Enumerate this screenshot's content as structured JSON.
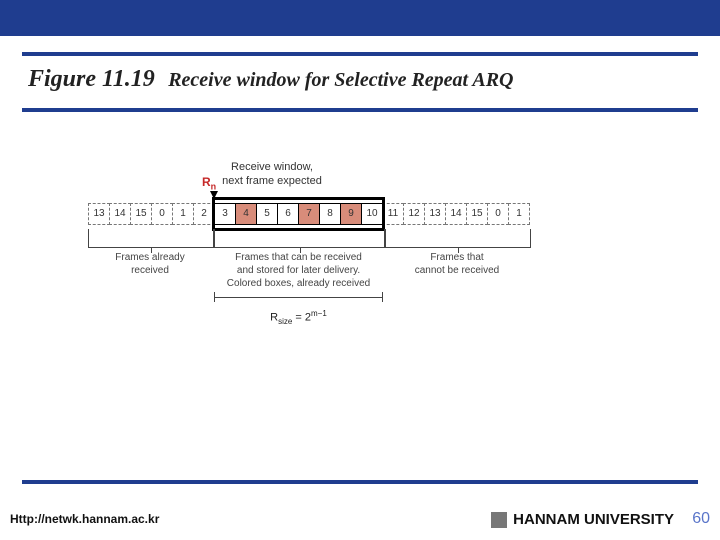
{
  "header": {
    "figure_label": "Figure 11.19",
    "figure_title": "Receive window for Selective Repeat ARQ"
  },
  "diagram": {
    "rn_symbol": "R",
    "rn_sub": "n",
    "rn_caption_l1": "Receive window,",
    "rn_caption_l2": "next frame expected",
    "cells": [
      "13",
      "14",
      "15",
      "0",
      "1",
      "2",
      "3",
      "4",
      "5",
      "6",
      "7",
      "8",
      "9",
      "10",
      "11",
      "12",
      "13",
      "14",
      "15",
      "0",
      "1"
    ],
    "window_start_index": 6,
    "window_end_index": 13,
    "marked_indices": [
      7,
      10,
      12
    ],
    "left_caption_l1": "Frames already",
    "left_caption_l2": "received",
    "mid_caption_l1": "Frames that can be received",
    "mid_caption_l2": "and stored for later delivery.",
    "mid_caption_l3": "Colored boxes, already received",
    "right_caption_l1": "Frames that",
    "right_caption_l2": "cannot be received",
    "rsize_label": "R",
    "rsize_sub": "size",
    "rsize_eq": " = 2",
    "rsize_sup": "m−1"
  },
  "footer": {
    "url": "Http://netwk.hannam.ac.kr",
    "university": "HANNAM  UNIVERSITY",
    "page": "60"
  }
}
